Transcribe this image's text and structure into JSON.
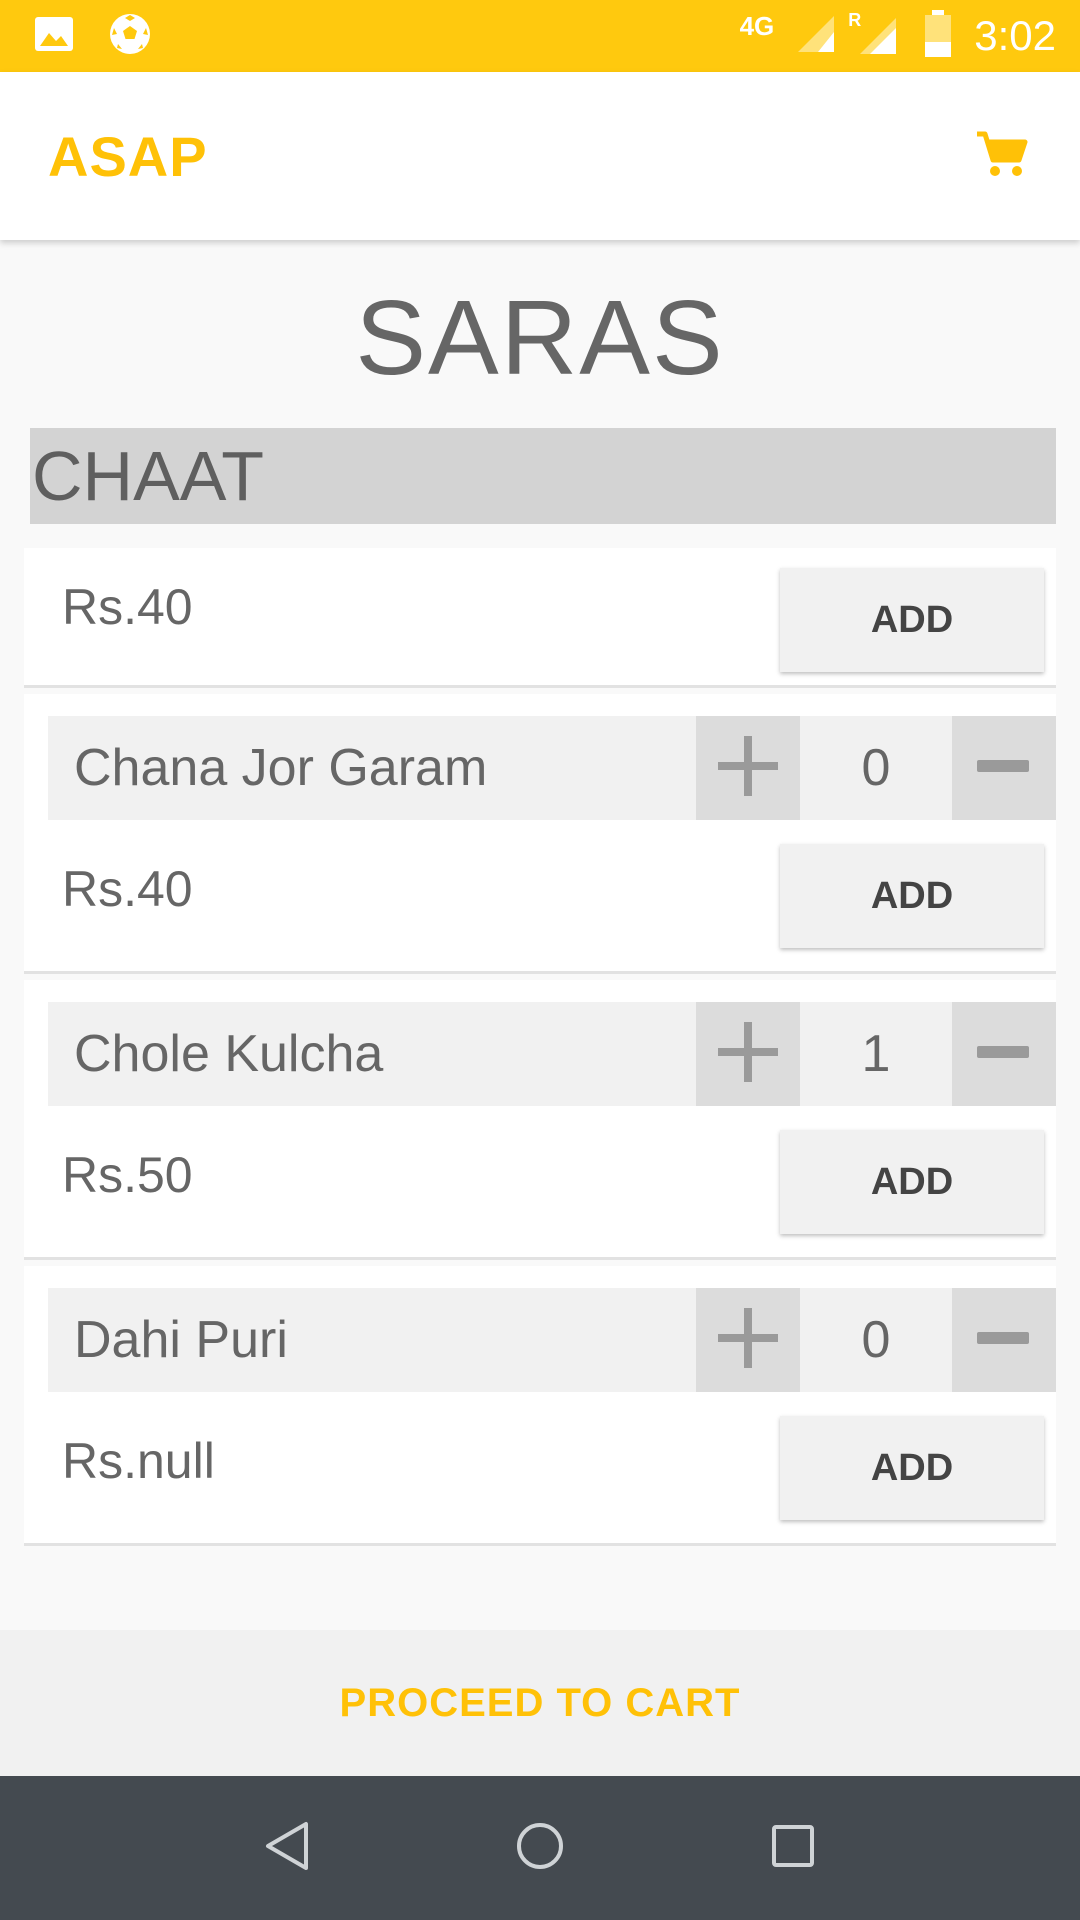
{
  "status_bar": {
    "network": "4G",
    "roaming": "R",
    "time": "3:02",
    "icons": [
      "gallery-icon",
      "soccer-ball-icon",
      "signal-icon",
      "roaming-signal-icon",
      "battery-icon"
    ]
  },
  "app_bar": {
    "title": "ASAP",
    "cart_icon": "shopping-cart-icon"
  },
  "restaurant": {
    "name": "SARAS"
  },
  "category": {
    "name": "CHAAT"
  },
  "items": [
    {
      "name": "",
      "quantity": "",
      "price": "Rs.40",
      "add_label": "ADD"
    },
    {
      "name": "Chana Jor Garam",
      "quantity": "0",
      "price": "Rs.40",
      "add_label": "ADD"
    },
    {
      "name": "Chole Kulcha",
      "quantity": "1",
      "price": "Rs.50",
      "add_label": "ADD"
    },
    {
      "name": "Dahi Puri",
      "quantity": "0",
      "price": "Rs.null",
      "add_label": "ADD"
    }
  ],
  "proceed": {
    "label": "PROCEED TO CART"
  },
  "colors": {
    "accent": "#ffc107",
    "status_bar": "#ffc90e",
    "nav_bar": "#444a50"
  },
  "nav": {
    "icons": [
      "back-icon",
      "home-icon",
      "recents-icon"
    ]
  }
}
